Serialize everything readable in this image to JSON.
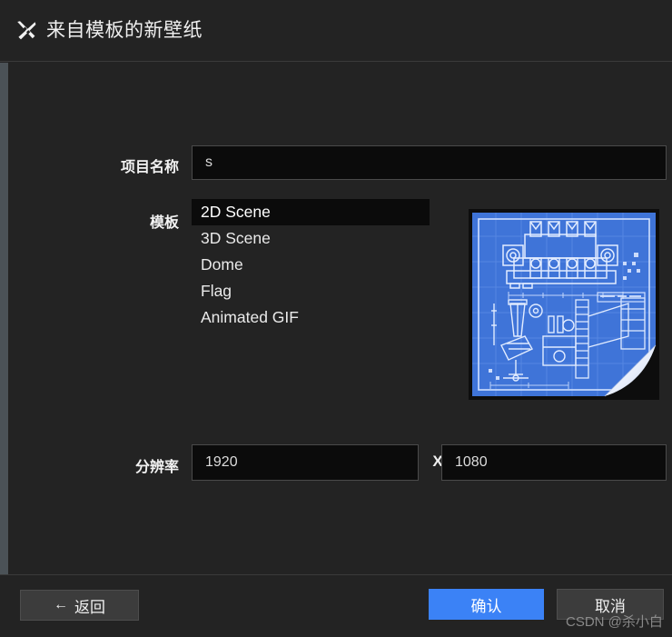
{
  "window": {
    "title": "来自模板的新壁纸",
    "title_icon": "crossed-tools-icon"
  },
  "form": {
    "name": {
      "label": "项目名称",
      "value": "s",
      "placeholder": ""
    },
    "template": {
      "label": "模板",
      "selected": "2D Scene",
      "options": [
        "2D Scene",
        "3D Scene",
        "Dome",
        "Flag",
        "Animated GIF"
      ]
    },
    "resolution": {
      "label": "分辨率",
      "width": "1920",
      "separator": "X",
      "height": "1080"
    }
  },
  "preview": {
    "name": "blueprint-thumbnail",
    "alt": "blueprint preview"
  },
  "footer": {
    "back_label": "返回",
    "back_arrow": "←",
    "confirm_label": "确认",
    "cancel_label": "取消"
  },
  "watermark": {
    "text": "CSDN @杀小白"
  },
  "colors": {
    "background": "#232323",
    "input_background": "#0b0b0b",
    "accent_blue": "#3b82f6",
    "button_grey": "#3c3c3c",
    "border": "#4a4a4a",
    "blueprint_blue": "#3f74d8",
    "left_strip": "#4b5257"
  }
}
